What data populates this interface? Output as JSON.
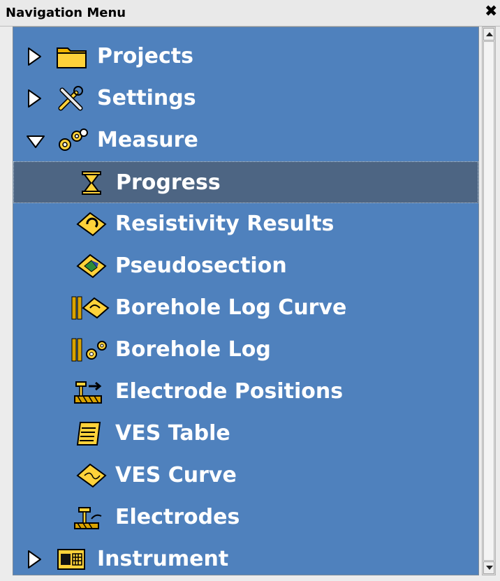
{
  "panel": {
    "title": "Navigation Menu",
    "close_symbol": "✖"
  },
  "colors": {
    "tree_background": "#4f81bd",
    "selected_row": "#4d6583",
    "label_text": "#ffffff"
  },
  "tree": {
    "items": [
      {
        "name": "projects",
        "label": "Projects",
        "icon": "folder-icon",
        "arrow": "collapsed"
      },
      {
        "name": "settings",
        "label": "Settings",
        "icon": "tools-icon",
        "arrow": "collapsed"
      },
      {
        "name": "measure",
        "label": "Measure",
        "icon": "gears-icon",
        "arrow": "expanded"
      },
      {
        "name": "progress",
        "label": "Progress",
        "icon": "hourglass-icon",
        "selected": true
      },
      {
        "name": "resistivity-results",
        "label": "Resistivity Results",
        "icon": "resistivity-results-icon"
      },
      {
        "name": "pseudosection",
        "label": "Pseudosection",
        "icon": "pseudosection-icon"
      },
      {
        "name": "borehole-log-curve",
        "label": "Borehole Log Curve",
        "icon": "borehole-log-curve-icon"
      },
      {
        "name": "borehole-log",
        "label": "Borehole Log",
        "icon": "borehole-log-icon"
      },
      {
        "name": "electrode-positions",
        "label": "Electrode Positions",
        "icon": "electrode-positions-icon"
      },
      {
        "name": "ves-table",
        "label": "VES Table",
        "icon": "ves-table-icon"
      },
      {
        "name": "ves-curve",
        "label": "VES Curve",
        "icon": "ves-curve-icon"
      },
      {
        "name": "electrodes",
        "label": "Electrodes",
        "icon": "electrodes-icon"
      },
      {
        "name": "instrument",
        "label": "Instrument",
        "icon": "instrument-icon",
        "arrow": "collapsed"
      }
    ]
  }
}
